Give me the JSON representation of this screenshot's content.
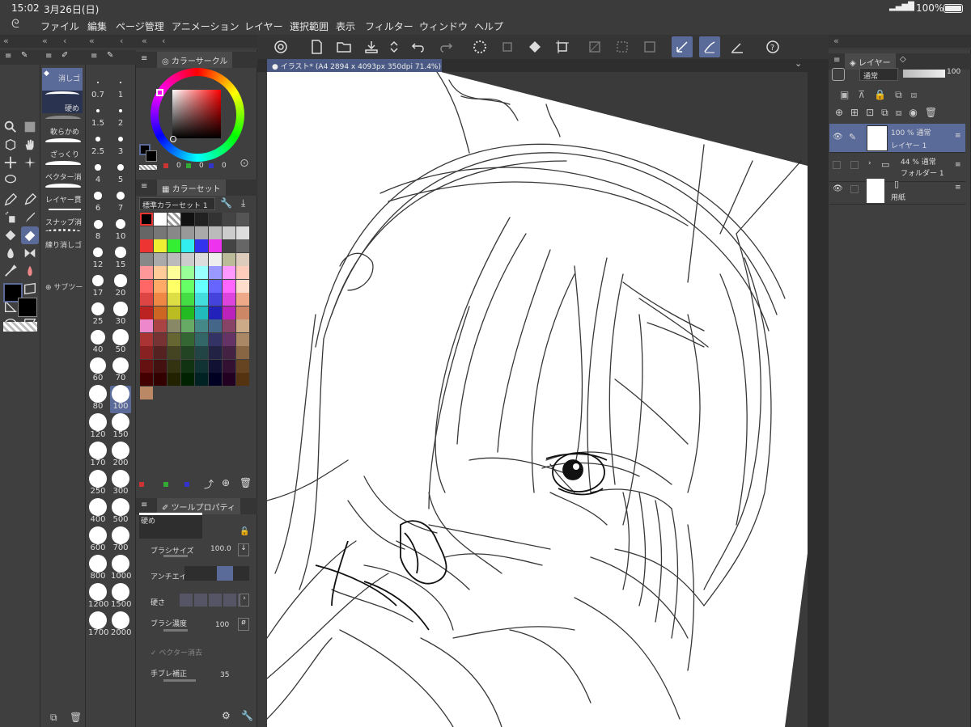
{
  "status": {
    "time": "15:02",
    "date": "3月26日(日)",
    "battery": "100%"
  },
  "menu": [
    "ファイル",
    "編集",
    "ページ管理",
    "アニメーション",
    "レイヤー",
    "選択範囲",
    "表示",
    "フィルター",
    "ウィンドウ",
    "ヘルプ"
  ],
  "brush_panel": {
    "items": [
      "消しゴ",
      "硬め",
      "軟らかめ",
      "ざっくり",
      "ベクター消",
      "レイヤー貫",
      "スナップ消",
      "練り消しゴ"
    ],
    "add_sub_tool": "サブツー"
  },
  "brush_sizes": {
    "left": [
      "0.7",
      "1.5",
      "2.5",
      "4",
      "6",
      "8",
      "12",
      "17",
      "25",
      "40",
      "60",
      "80",
      "120",
      "170",
      "250",
      "400",
      "600",
      "800",
      "1200",
      "1700"
    ],
    "right": [
      "1",
      "2",
      "3",
      "5",
      "7",
      "10",
      "15",
      "20",
      "30",
      "50",
      "70",
      "100",
      "150",
      "200",
      "300",
      "500",
      "700",
      "1000",
      "1500",
      "2000"
    ]
  },
  "color_circle": {
    "tab": "カラーサークル",
    "values": [
      "0",
      "0",
      "0"
    ]
  },
  "color_set": {
    "tab": "カラーセット",
    "selected": "標準カラーセット 1"
  },
  "tool_property": {
    "tab": "ツールプロパティ",
    "preset": "硬め",
    "brush_size_label": "ブラシサイズ",
    "brush_size": "100.0",
    "antialias_label": "アンチエイリ",
    "hardness_label": "硬さ",
    "density_label": "ブラシ濃度",
    "density": "100",
    "vector_erase": "ベクター消去",
    "stabilization_label": "手ブレ補正",
    "stabilization": "35"
  },
  "canvas": {
    "tab_title": "イラスト* (A4 2894 x 4093px 350dpi 71.4%)"
  },
  "layer_panel": {
    "tab": "レイヤー",
    "blend_mode": "通常",
    "opacity": "100",
    "layers": [
      {
        "pct": "100 % 通常",
        "name": "レイヤー 1"
      },
      {
        "pct": "44 % 通常",
        "name": "フォルダー 1"
      },
      {
        "pct": "",
        "name": "用紙"
      }
    ]
  },
  "colors": {
    "accent": "#5a6a99",
    "panel": "#3f3f3f",
    "dark": "#2e2e2e"
  }
}
